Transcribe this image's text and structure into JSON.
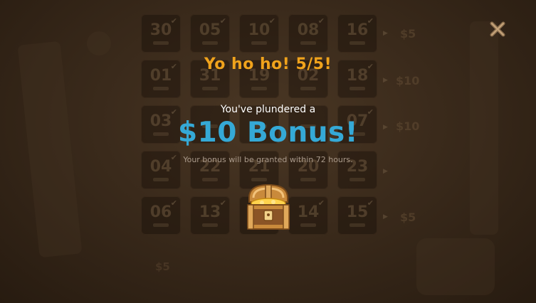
{
  "dialog": {
    "title": "Yo ho ho! 5/5!",
    "subtitle": "You've plundered a",
    "bonus_amount": "$10 Bonus!",
    "note": "Your bonus will be granted within 72 hours."
  },
  "icons": {
    "close": "close-x-icon",
    "chest": "treasure-chest-icon"
  },
  "colors": {
    "title": "#f0a31c",
    "bonus": "#35a9d6",
    "background": "#3a2a1b"
  },
  "background_board": {
    "rows": [
      {
        "dates": [
          "30",
          "05",
          "10",
          "08",
          "16"
        ],
        "prize": "$5"
      },
      {
        "dates": [
          "01",
          "31",
          "19",
          "02",
          "18"
        ],
        "prize": "$10"
      },
      {
        "dates": [
          "03",
          "",
          "",
          "",
          "07"
        ],
        "prize": "$10"
      },
      {
        "dates": [
          "04",
          "22",
          "21",
          "20",
          "23"
        ],
        "prize": ""
      },
      {
        "dates": [
          "06",
          "13",
          "",
          "14",
          "15"
        ],
        "prize": "$5"
      }
    ],
    "column_prizes": [
      "$5"
    ]
  }
}
